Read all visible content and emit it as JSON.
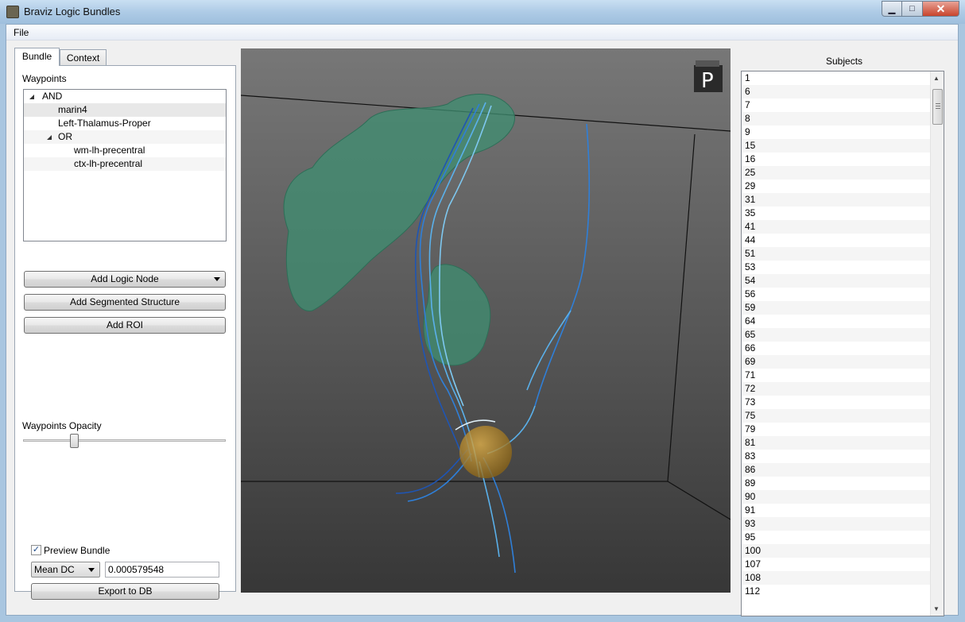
{
  "window": {
    "title": "Braviz Logic Bundles",
    "min": "▁",
    "max": "□",
    "close": "✕"
  },
  "menu": {
    "file": "File"
  },
  "tabs": {
    "bundle": "Bundle",
    "context": "Context"
  },
  "waypoints": {
    "label": "Waypoints",
    "tree": [
      {
        "label": "AND",
        "level": 0,
        "expandable": true
      },
      {
        "label": "marin4",
        "level": 1,
        "expandable": false,
        "selected": true
      },
      {
        "label": "Left-Thalamus-Proper",
        "level": 1,
        "expandable": false
      },
      {
        "label": "OR",
        "level": 1,
        "expandable": true
      },
      {
        "label": "wm-lh-precentral",
        "level": 2,
        "expandable": false
      },
      {
        "label": "ctx-lh-precentral",
        "level": 2,
        "expandable": false
      }
    ]
  },
  "buttons": {
    "add_logic_node": "Add Logic Node",
    "add_segmented_structure": "Add Segmented Structure",
    "add_roi": "Add ROI",
    "export_to_db": "Export to DB"
  },
  "opacity": {
    "label": "Waypoints Opacity",
    "value": 0.25
  },
  "preview": {
    "label": "Preview Bundle",
    "checked": true,
    "check_mark": "✓"
  },
  "metric": {
    "selected": "Mean DC",
    "value": "0.000579548"
  },
  "viewport": {
    "orientation_label": "P"
  },
  "subjects": {
    "title": "Subjects",
    "items": [
      "1",
      "6",
      "7",
      "8",
      "9",
      "15",
      "16",
      "25",
      "29",
      "31",
      "35",
      "41",
      "44",
      "51",
      "53",
      "54",
      "56",
      "59",
      "64",
      "65",
      "66",
      "69",
      "71",
      "72",
      "73",
      "75",
      "79",
      "81",
      "83",
      "86",
      "89",
      "90",
      "91",
      "93",
      "95",
      "100",
      "107",
      "108",
      "112"
    ]
  }
}
